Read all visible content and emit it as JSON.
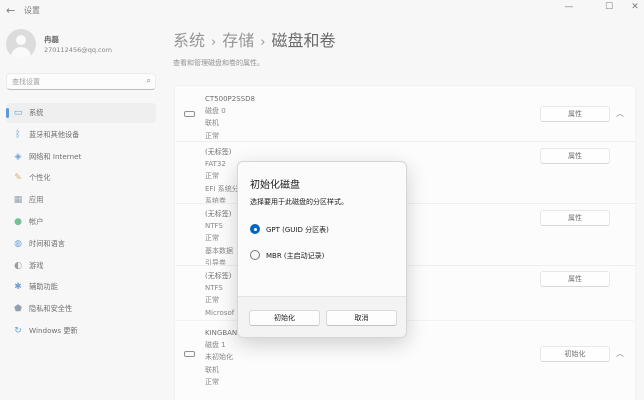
{
  "window": {
    "title": "设置",
    "back_glyph": "←",
    "min_glyph": "—",
    "max_glyph": "☐",
    "close_glyph": "✕"
  },
  "profile": {
    "name": "冉磊",
    "email": "270112456@qq.com"
  },
  "search": {
    "placeholder": "查找设置",
    "icon_glyph": "⌕"
  },
  "nav": {
    "items": [
      {
        "label": "系统",
        "icon": "monitor-icon",
        "glyph": "▭",
        "color": "#0067c0",
        "active": true
      },
      {
        "label": "蓝牙和其他设备",
        "icon": "bluetooth-icon",
        "glyph": "ᛒ",
        "color": "#0067c0"
      },
      {
        "label": "网络和 Internet",
        "icon": "wifi-icon",
        "glyph": "◈",
        "color": "#1d6fc2"
      },
      {
        "label": "个性化",
        "icon": "brush-icon",
        "glyph": "✎",
        "color": "#d07a2a"
      },
      {
        "label": "应用",
        "icon": "apps-icon",
        "glyph": "▦",
        "color": "#5a6b86"
      },
      {
        "label": "帐户",
        "icon": "account-icon",
        "glyph": "●",
        "color": "#2aa05a"
      },
      {
        "label": "时间和语言",
        "icon": "globe-clock-icon",
        "glyph": "◍",
        "color": "#1d6fc2"
      },
      {
        "label": "游戏",
        "icon": "gamepad-icon",
        "glyph": "◐",
        "color": "#666666"
      },
      {
        "label": "辅助功能",
        "icon": "accessibility-icon",
        "glyph": "✱",
        "color": "#1d6fc2"
      },
      {
        "label": "隐私和安全性",
        "icon": "shield-icon",
        "glyph": "⬟",
        "color": "#5a6b86"
      },
      {
        "label": "Windows 更新",
        "icon": "update-icon",
        "glyph": "↻",
        "color": "#1d6fc2"
      }
    ]
  },
  "breadcrumb": {
    "items": [
      "系统",
      "存储",
      "磁盘和卷"
    ],
    "sep_glyph": "›"
  },
  "subtitle": "查看和管理磁盘和卷的属性。",
  "disk0": {
    "name": "CT500P2SSD8",
    "lines": [
      "磁盘 0",
      "联机",
      "正常"
    ],
    "button": "属性",
    "chevron": "︿"
  },
  "volumes": [
    {
      "lines": [
        "(无标签)",
        "FAT32",
        "正常",
        "EFI 系统分",
        "系统卷"
      ],
      "button": "属性"
    },
    {
      "lines": [
        "(无标签)",
        "NTFS",
        "正常",
        "基本数据",
        "引导卷"
      ],
      "button": "属性"
    },
    {
      "lines": [
        "(无标签)",
        "NTFS",
        "正常",
        "Microsof"
      ],
      "button": "属性"
    }
  ],
  "disk1": {
    "name": "KINGBAN",
    "lines": [
      "磁盘 1",
      "未初始化",
      "联机",
      "正常"
    ],
    "button": "初始化",
    "chevron": "︿"
  },
  "dialog": {
    "title": "初始化磁盘",
    "description": "选择要用于此磁盘的分区样式。",
    "options": [
      {
        "label": "GPT (GUID 分区表)",
        "checked": true
      },
      {
        "label": "MBR (主启动记录)",
        "checked": false
      }
    ],
    "init_button": "初始化",
    "cancel_button": "取消"
  }
}
